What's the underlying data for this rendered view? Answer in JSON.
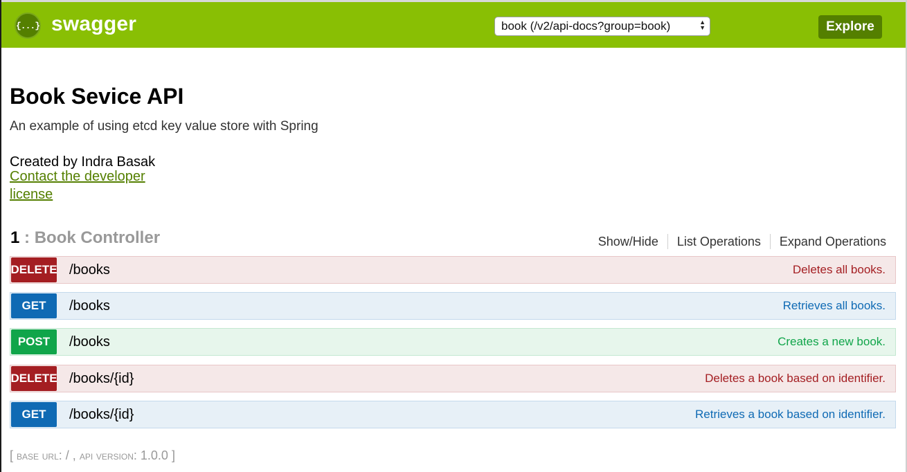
{
  "header": {
    "logo_glyph": "{...}",
    "brand": "swagger",
    "selected_spec": "book (/v2/api-docs?group=book)",
    "explore_label": "Explore",
    "accent_color": "#89bf04"
  },
  "info": {
    "title": "Book Sevice API",
    "description": "An example of using etcd key value store with Spring",
    "created_by": "Created by Indra Basak",
    "contact_link": "Contact the developer",
    "license_link": "license"
  },
  "resource": {
    "number": "1",
    "separator": ":",
    "name": "Book Controller",
    "actions": {
      "show_hide": "Show/Hide",
      "list_operations": "List Operations",
      "expand_operations": "Expand Operations"
    }
  },
  "operations": [
    {
      "method": "DELETE",
      "path": "/books",
      "summary": "Deletes all books.",
      "color": "#a41e22"
    },
    {
      "method": "GET",
      "path": "/books",
      "summary": "Retrieves all books.",
      "color": "#0f6ab4"
    },
    {
      "method": "POST",
      "path": "/books",
      "summary": "Creates a new book.",
      "color": "#10a54a"
    },
    {
      "method": "DELETE",
      "path": "/books/{id}",
      "summary": "Deletes a book based on identifier.",
      "color": "#a41e22"
    },
    {
      "method": "GET",
      "path": "/books/{id}",
      "summary": "Retrieves a book based on identifier.",
      "color": "#0f6ab4"
    }
  ],
  "footer": {
    "open_bracket": "[",
    "base_url_label": "base url",
    "base_url_value": ": / ,",
    "api_version_label": "api version",
    "api_version_value": ": 1.0.0",
    "close_bracket": "]"
  }
}
